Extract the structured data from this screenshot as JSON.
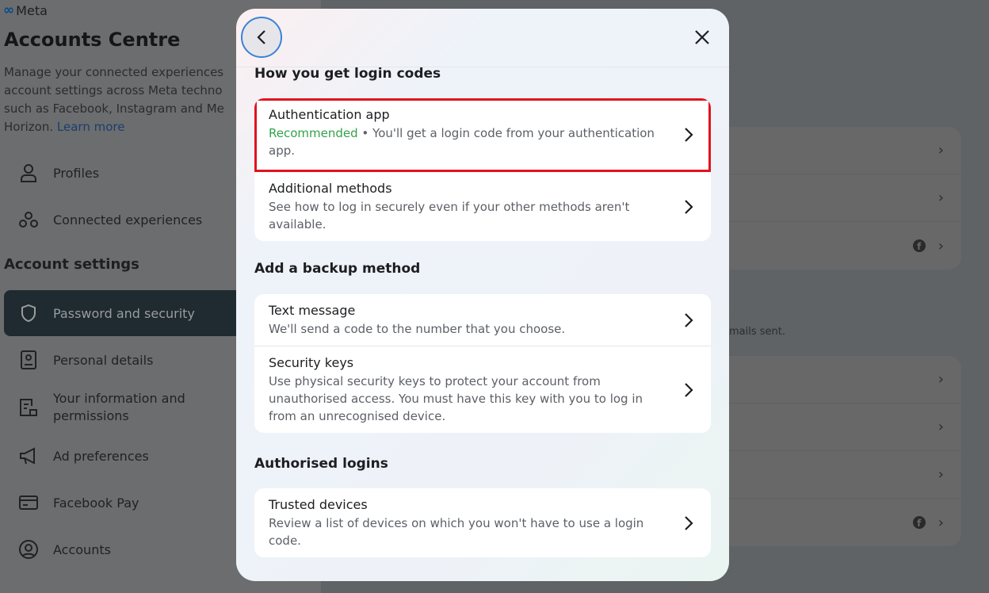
{
  "brand": {
    "logo": "Meta",
    "logo_mark": "∞"
  },
  "sidebar": {
    "title": "Accounts Centre",
    "description": "Manage your connected experiences and account settings across Meta technologies such as Facebook, Instagram and Meta Horizon.",
    "desc_lines": [
      "Manage your connected experiences",
      "account settings across Meta techno",
      "such as Facebook, Instagram and Me",
      "Horizon."
    ],
    "learn_more": "Learn more",
    "items": [
      {
        "label": "Profiles",
        "icon": "person-icon"
      },
      {
        "label": "Connected experiences",
        "icon": "connected-icon"
      }
    ],
    "section": "Account settings",
    "settings": [
      {
        "label": "Password and security",
        "icon": "shield-icon",
        "selected": true
      },
      {
        "label": "Personal details",
        "icon": "id-card-icon"
      },
      {
        "label": "Your information and permissions",
        "icon": "document-lock-icon"
      },
      {
        "label": "Ad preferences",
        "icon": "megaphone-icon"
      },
      {
        "label": "Facebook Pay",
        "icon": "card-icon"
      },
      {
        "label": "Accounts",
        "icon": "account-circle-icon"
      }
    ]
  },
  "background": {
    "partial_text": "mails sent."
  },
  "modal": {
    "sections": [
      {
        "title": "How you get login codes",
        "items": [
          {
            "title": "Authentication app",
            "badge": "Recommended",
            "desc": " • You'll get a login code from your authentication app.",
            "highlighted": true
          },
          {
            "title": "Additional methods",
            "desc": "See how to log in securely even if your other methods aren't available."
          }
        ]
      },
      {
        "title": "Add a backup method",
        "items": [
          {
            "title": "Text message",
            "desc": "We'll send a code to the number that you choose."
          },
          {
            "title": "Security keys",
            "desc": "Use physical security keys to protect your account from unauthorised access. You must have this key with you to log in from an unrecognised device."
          }
        ]
      },
      {
        "title": "Authorised logins",
        "items": [
          {
            "title": "Trusted devices",
            "desc": "Review a list of devices on which you won't have to use a login code."
          }
        ]
      }
    ]
  },
  "colors": {
    "accent": "#31a24c",
    "highlight": "#e0141e",
    "focus_ring": "#3b82d6",
    "selected_nav": "#1f2a31"
  }
}
